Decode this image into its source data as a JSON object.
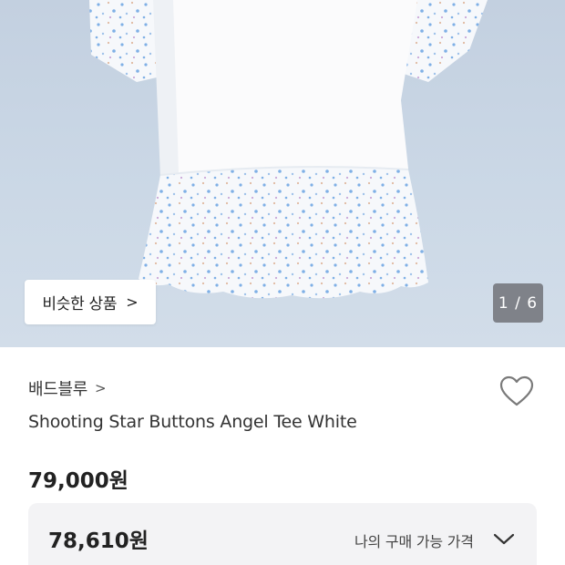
{
  "hero": {
    "image_alt": "White T-shirt dress with star-print sleeves and ruffle hem",
    "similar_button_label": "비슷한 상품",
    "similar_button_chevron": ">",
    "counter": "1 / 6"
  },
  "product": {
    "brand": "배드블루",
    "brand_chevron": ">",
    "name": "Shooting Star Buttons Angel Tee White",
    "price": "79,000원"
  },
  "member": {
    "price": "78,610원",
    "label": "나의 구매 가능 가격"
  },
  "icons": {
    "wishlist": "heart-outline-icon",
    "expand": "chevron-down-icon"
  },
  "colors": {
    "background_hero": "#c8d5e4",
    "star_blue": "#7fb0e6",
    "text": "#222222",
    "panel": "#f3f3f5"
  }
}
